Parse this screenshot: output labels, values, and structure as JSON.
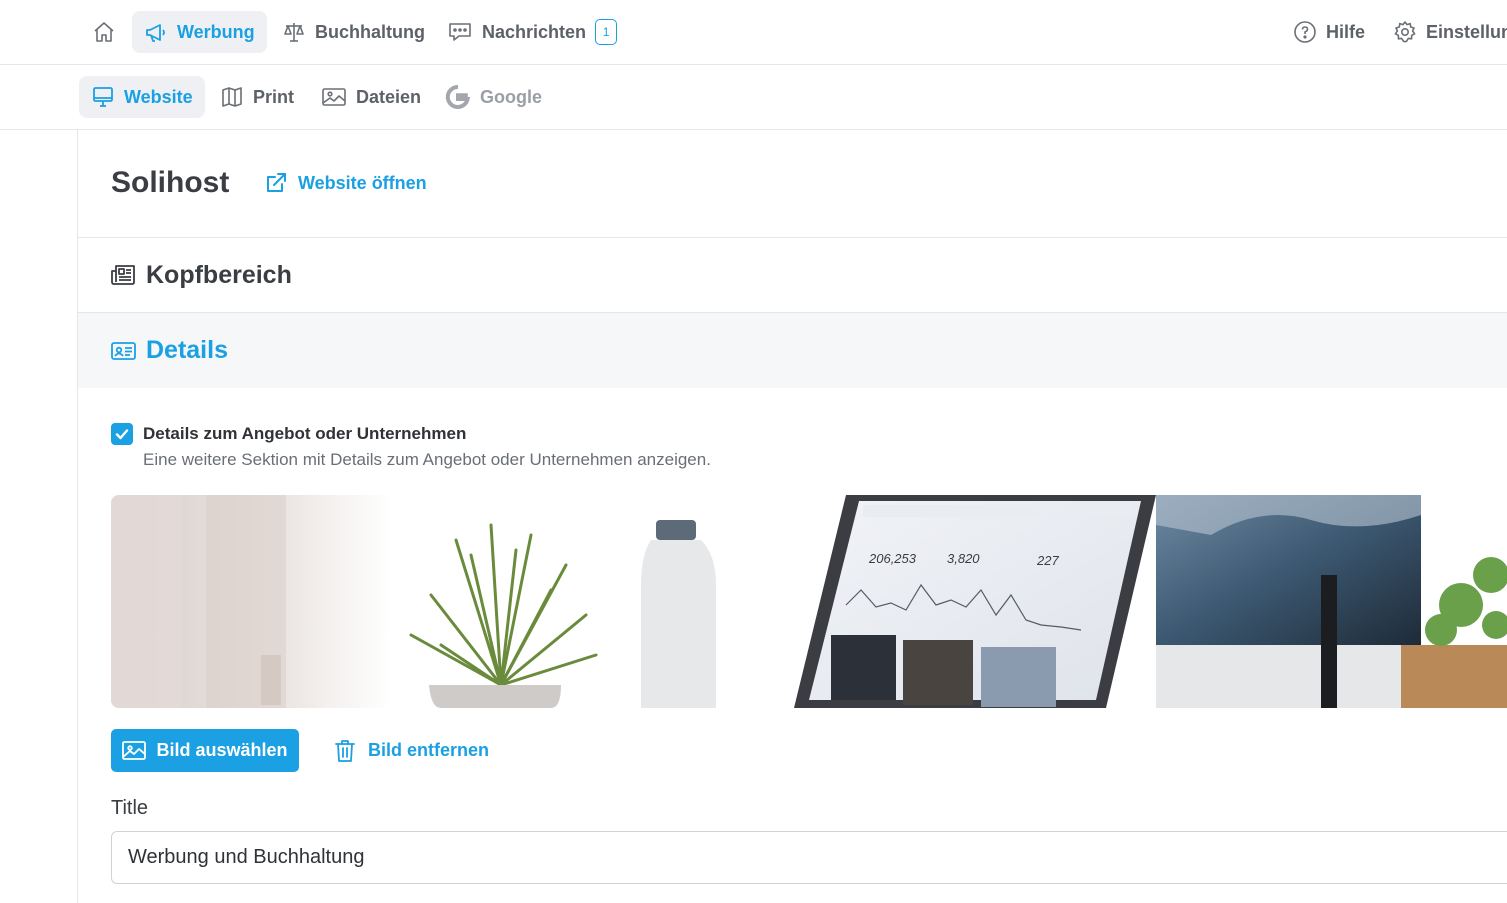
{
  "topnav": {
    "home_icon": "home-icon",
    "items": [
      {
        "label": "Werbung",
        "icon": "megaphone-icon",
        "active": true
      },
      {
        "label": "Buchhaltung",
        "icon": "scale-icon",
        "active": false
      },
      {
        "label": "Nachrichten",
        "icon": "chat-icon",
        "active": false,
        "badge": "1"
      }
    ],
    "right": [
      {
        "label": "Hilfe",
        "icon": "help-icon"
      },
      {
        "label": "Einstellun",
        "icon": "gear-icon"
      }
    ]
  },
  "subnav": {
    "items": [
      {
        "label": "Website",
        "icon": "monitor-icon",
        "active": true
      },
      {
        "label": "Print",
        "icon": "map-icon",
        "active": false
      },
      {
        "label": "Dateien",
        "icon": "image-icon",
        "active": false
      },
      {
        "label": "Google",
        "icon": "google-icon",
        "active": false
      }
    ]
  },
  "page": {
    "title": "Solihost",
    "open_link": "Website öffnen"
  },
  "sections": {
    "kopfbereich": "Kopfbereich",
    "details": "Details"
  },
  "details": {
    "checkbox_checked": true,
    "checkbox_title": "Details zum Angebot oder Unternehmen",
    "checkbox_desc": "Eine weitere Sektion mit Details zum Angebot oder Unternehmen anzeigen.",
    "hero_stats": [
      "206,253",
      "3,820",
      "227"
    ],
    "select_image_label": "Bild auswählen",
    "remove_image_label": "Bild entfernen",
    "title_label": "Title",
    "title_value": "Werbung und Buchhaltung"
  },
  "colors": {
    "accent": "#1aa0e3",
    "text": "#3a3d42",
    "muted": "#5d6168",
    "border": "#e4e6ea"
  }
}
